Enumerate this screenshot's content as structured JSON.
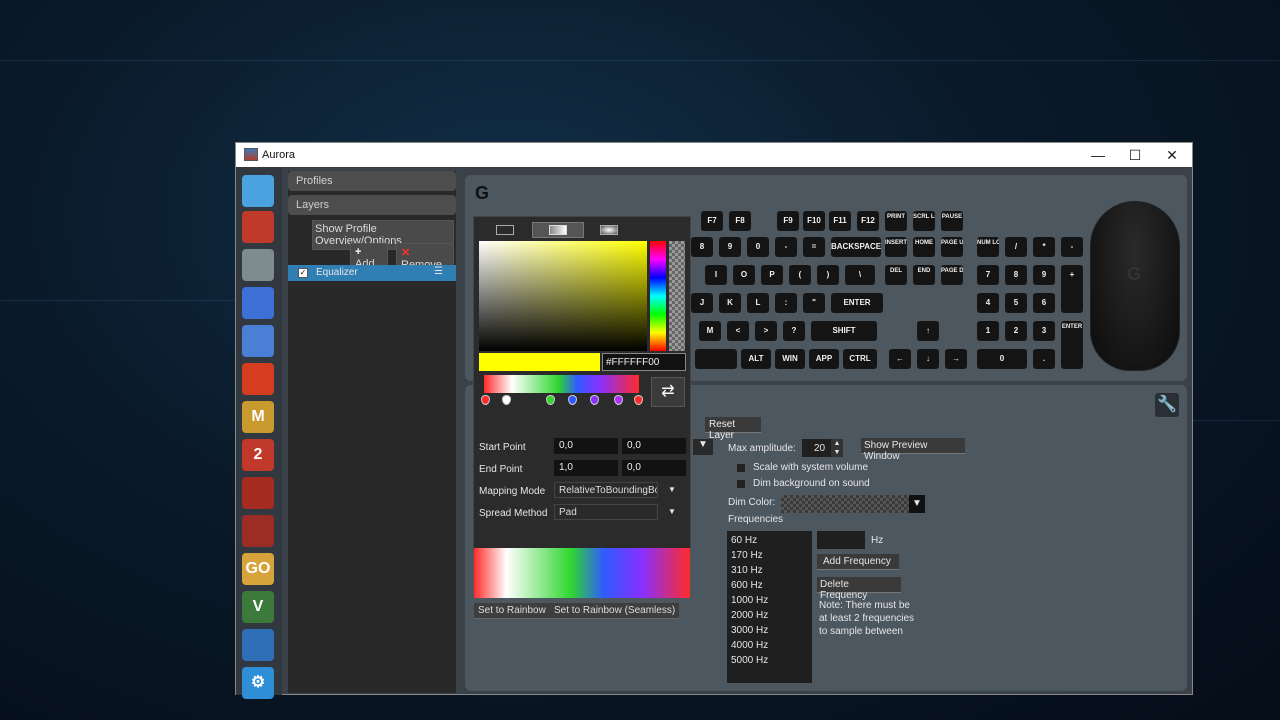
{
  "window": {
    "title": "Aurora",
    "minimize": "—",
    "maximize": "☐",
    "close": "✕"
  },
  "sidebar": {
    "games": [
      {
        "icon": "monitor-icon",
        "label": "",
        "color": "#4aa3e0"
      },
      {
        "icon": "wolf-icon",
        "label": "",
        "color": "#c0392b"
      },
      {
        "icon": "robot-icon",
        "label": "",
        "color": "#7f8c8d"
      },
      {
        "icon": "planet-icon",
        "label": "",
        "color": "#3d6fd6"
      },
      {
        "icon": "cross-icon",
        "label": "",
        "color": "#4a7fd6"
      },
      {
        "icon": "flame-icon",
        "label": "",
        "color": "#d63c1f"
      },
      {
        "icon": "m-logo-icon",
        "label": "M",
        "color": "#c99a2e"
      },
      {
        "icon": "gw2-icon",
        "label": "2",
        "color": "#c0392b"
      },
      {
        "icon": "dragon-icon",
        "label": "",
        "color": "#a52a1f"
      },
      {
        "icon": "dota-icon",
        "label": "",
        "color": "#9b2d25"
      },
      {
        "icon": "csgo-icon",
        "label": "GO",
        "color": "#d6a43a"
      },
      {
        "icon": "gta-v-icon",
        "label": "V",
        "color": "#3c7a3c"
      },
      {
        "icon": "rocket-league-icon",
        "label": "",
        "color": "#2f6fb8"
      },
      {
        "icon": "settings-gear-icon",
        "label": "⚙",
        "color": "#2f8fd6"
      }
    ]
  },
  "panel": {
    "profiles_header": "Profiles",
    "layers_header": "Layers",
    "show_overview": "Show Profile Overview/Options",
    "add": "Add",
    "remove": "Remove",
    "layer_name": "Equalizer"
  },
  "keyboard": {
    "fn_row": [
      "F7",
      "F8",
      "F9",
      "F10",
      "F11",
      "F12",
      "PRINT",
      "SCRL LOCK",
      "PAUSE"
    ],
    "num_row": [
      "8",
      "9",
      "0",
      "-",
      "=",
      "BACKSPACE",
      "INSERT",
      "HOME",
      "PAGE UP",
      "NUM LOCK",
      "/",
      "*",
      "-"
    ],
    "row_q": [
      "I",
      "O",
      "P",
      "(",
      ")",
      "\\",
      "DEL",
      "END",
      "PAGE DOWN",
      "7",
      "8",
      "9",
      "+"
    ],
    "row_a": [
      "J",
      "K",
      "L",
      ":",
      "\"",
      "ENTER",
      "4",
      "5",
      "6"
    ],
    "row_z": [
      "M",
      "<",
      ">",
      "?",
      "SHIFT",
      "↑",
      "1",
      "2",
      "3",
      "ENTER"
    ],
    "row_ctrl": [
      "ALT",
      "WIN",
      "APP",
      "CTRL",
      "←",
      "↓",
      "→",
      "0",
      "."
    ]
  },
  "editor": {
    "reset_layer": "Reset Layer",
    "max_amplitude_label": "Max amplitude:",
    "max_amplitude_value": "20",
    "show_preview": "Show Preview Window",
    "scale_volume": "Scale with system volume",
    "dim_bg": "Dim background on sound",
    "dim_color": "Dim Color:",
    "frequencies_label": "Frequencies",
    "frequencies": [
      "60 Hz",
      "170 Hz",
      "310 Hz",
      "600 Hz",
      "1000 Hz",
      "2000 Hz",
      "3000 Hz",
      "4000 Hz",
      "5000 Hz"
    ],
    "hz_unit": "Hz",
    "add_frequency": "Add Frequency",
    "delete_frequency": "Delete Frequency",
    "note": "Note: There must be at least 2 frequencies to sample between"
  },
  "picker": {
    "hex": "#FFFFFF00",
    "start_point": "Start Point",
    "start_x": "0,0",
    "start_y": "0,0",
    "end_point": "End Point",
    "end_x": "1,0",
    "end_y": "0,0",
    "mapping_mode": "Mapping Mode",
    "mapping_value": "RelativeToBoundingBox",
    "spread_method": "Spread Method",
    "spread_value": "Pad",
    "set_rainbow": "Set to Rainbow",
    "set_rainbow_seamless": "Set to Rainbow (Seamless)",
    "stop_colors": [
      "#ff2b2b",
      "#ffffff",
      "#2fd62f",
      "#2f5bff",
      "#8a2fff",
      "#b02fff",
      "#ff2b2b"
    ]
  },
  "colors": {
    "accent": "#2f7fb5",
    "yellow": "#ffff00"
  }
}
